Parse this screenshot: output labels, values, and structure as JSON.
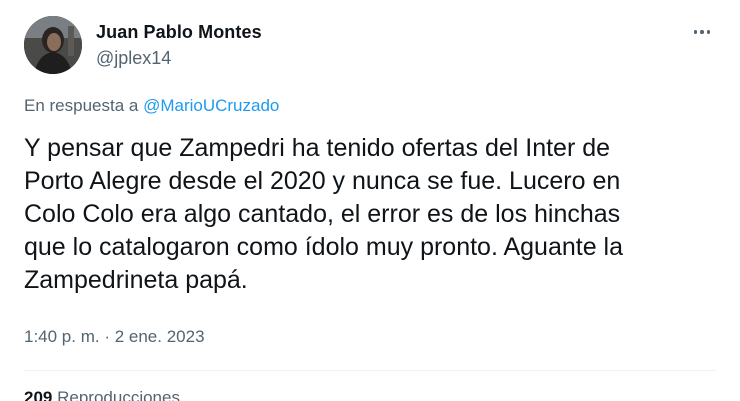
{
  "author": {
    "display_name": "Juan Pablo Montes",
    "handle": "@jplex14",
    "avatar_icon": "profile-photo"
  },
  "more_icon": "more-horizontal-icon",
  "reply": {
    "prefix": "En respuesta a ",
    "mention": "@MarioUCruzado"
  },
  "tweet": {
    "text": "Y pensar que Zampedri ha tenido ofertas del Inter de\nPorto Alegre desde el 2020 y nunca se fue. Lucero en\nColo Colo era algo cantado, el error es de los hinchas\nque lo catalogaron como ídolo muy pronto. Aguante la\nZampedrineta papá.",
    "time": "1:40 p. m.",
    "separator": " · ",
    "date": "2 ene. 2023"
  },
  "stats": {
    "count": "209",
    "label": "Reproducciones"
  },
  "colors": {
    "text": "#0f1419",
    "secondary": "#536471",
    "link": "#1d9bf0"
  }
}
